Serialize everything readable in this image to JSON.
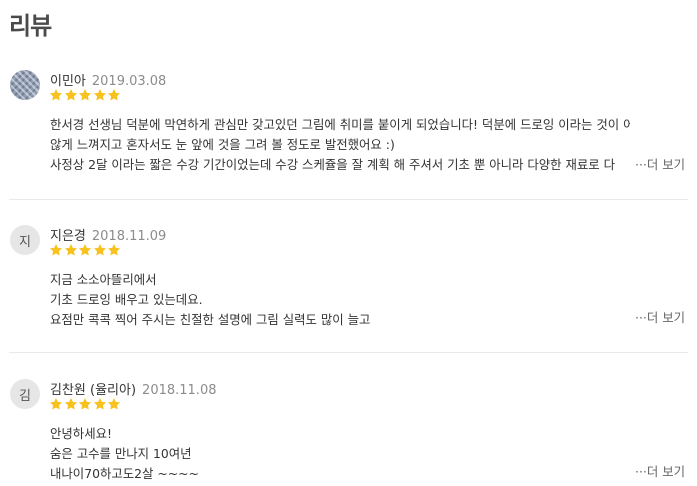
{
  "section": {
    "title": "리뷰"
  },
  "reviews": [
    {
      "avatar_text": "",
      "name": "이민아",
      "date": "2019.03.08",
      "rating": 5,
      "lines": [
        "한서경 선생님 덕분에 막연하게 관심만 갖고있던 그림에 취미를 붙이게 되었습니다! 덕분에 드로잉 이라는 것이 어렵지",
        "않게 느껴지고 혼자서도 눈 앞에 것을 그려 볼 정도로 발전했어요 :)",
        "사정상 2달 이라는 짧은 수강 기간이었는데 수강 스케쥴을 잘 계획 해 주셔서 기초 뿐 아니라 다양한 재료로 다"
      ],
      "more_label": "···더 보기"
    },
    {
      "avatar_text": "지",
      "name": "지은경",
      "date": "2018.11.09",
      "rating": 5,
      "lines": [
        "지금 소소아뜰리에서",
        "기초 드로잉 배우고 있는데요.",
        "요점만 콕콕 찍어 주시는 친절한 설명에 그림 실력도 많이 늘고"
      ],
      "more_label": "···더 보기"
    },
    {
      "avatar_text": "김",
      "name": "김찬원 (율리아)",
      "date": "2018.11.08",
      "rating": 5,
      "lines": [
        "안녕하세요!",
        "숨은 고수를 만나지 10여년",
        "내나이70하고도2살 ~~~~"
      ],
      "more_label": "···더 보기"
    }
  ],
  "colors": {
    "star": "#f7c21d",
    "avatar_bg": "#e6e6e6",
    "divider": "#e9e9e9"
  },
  "icons": {
    "rating": "star-icon"
  }
}
